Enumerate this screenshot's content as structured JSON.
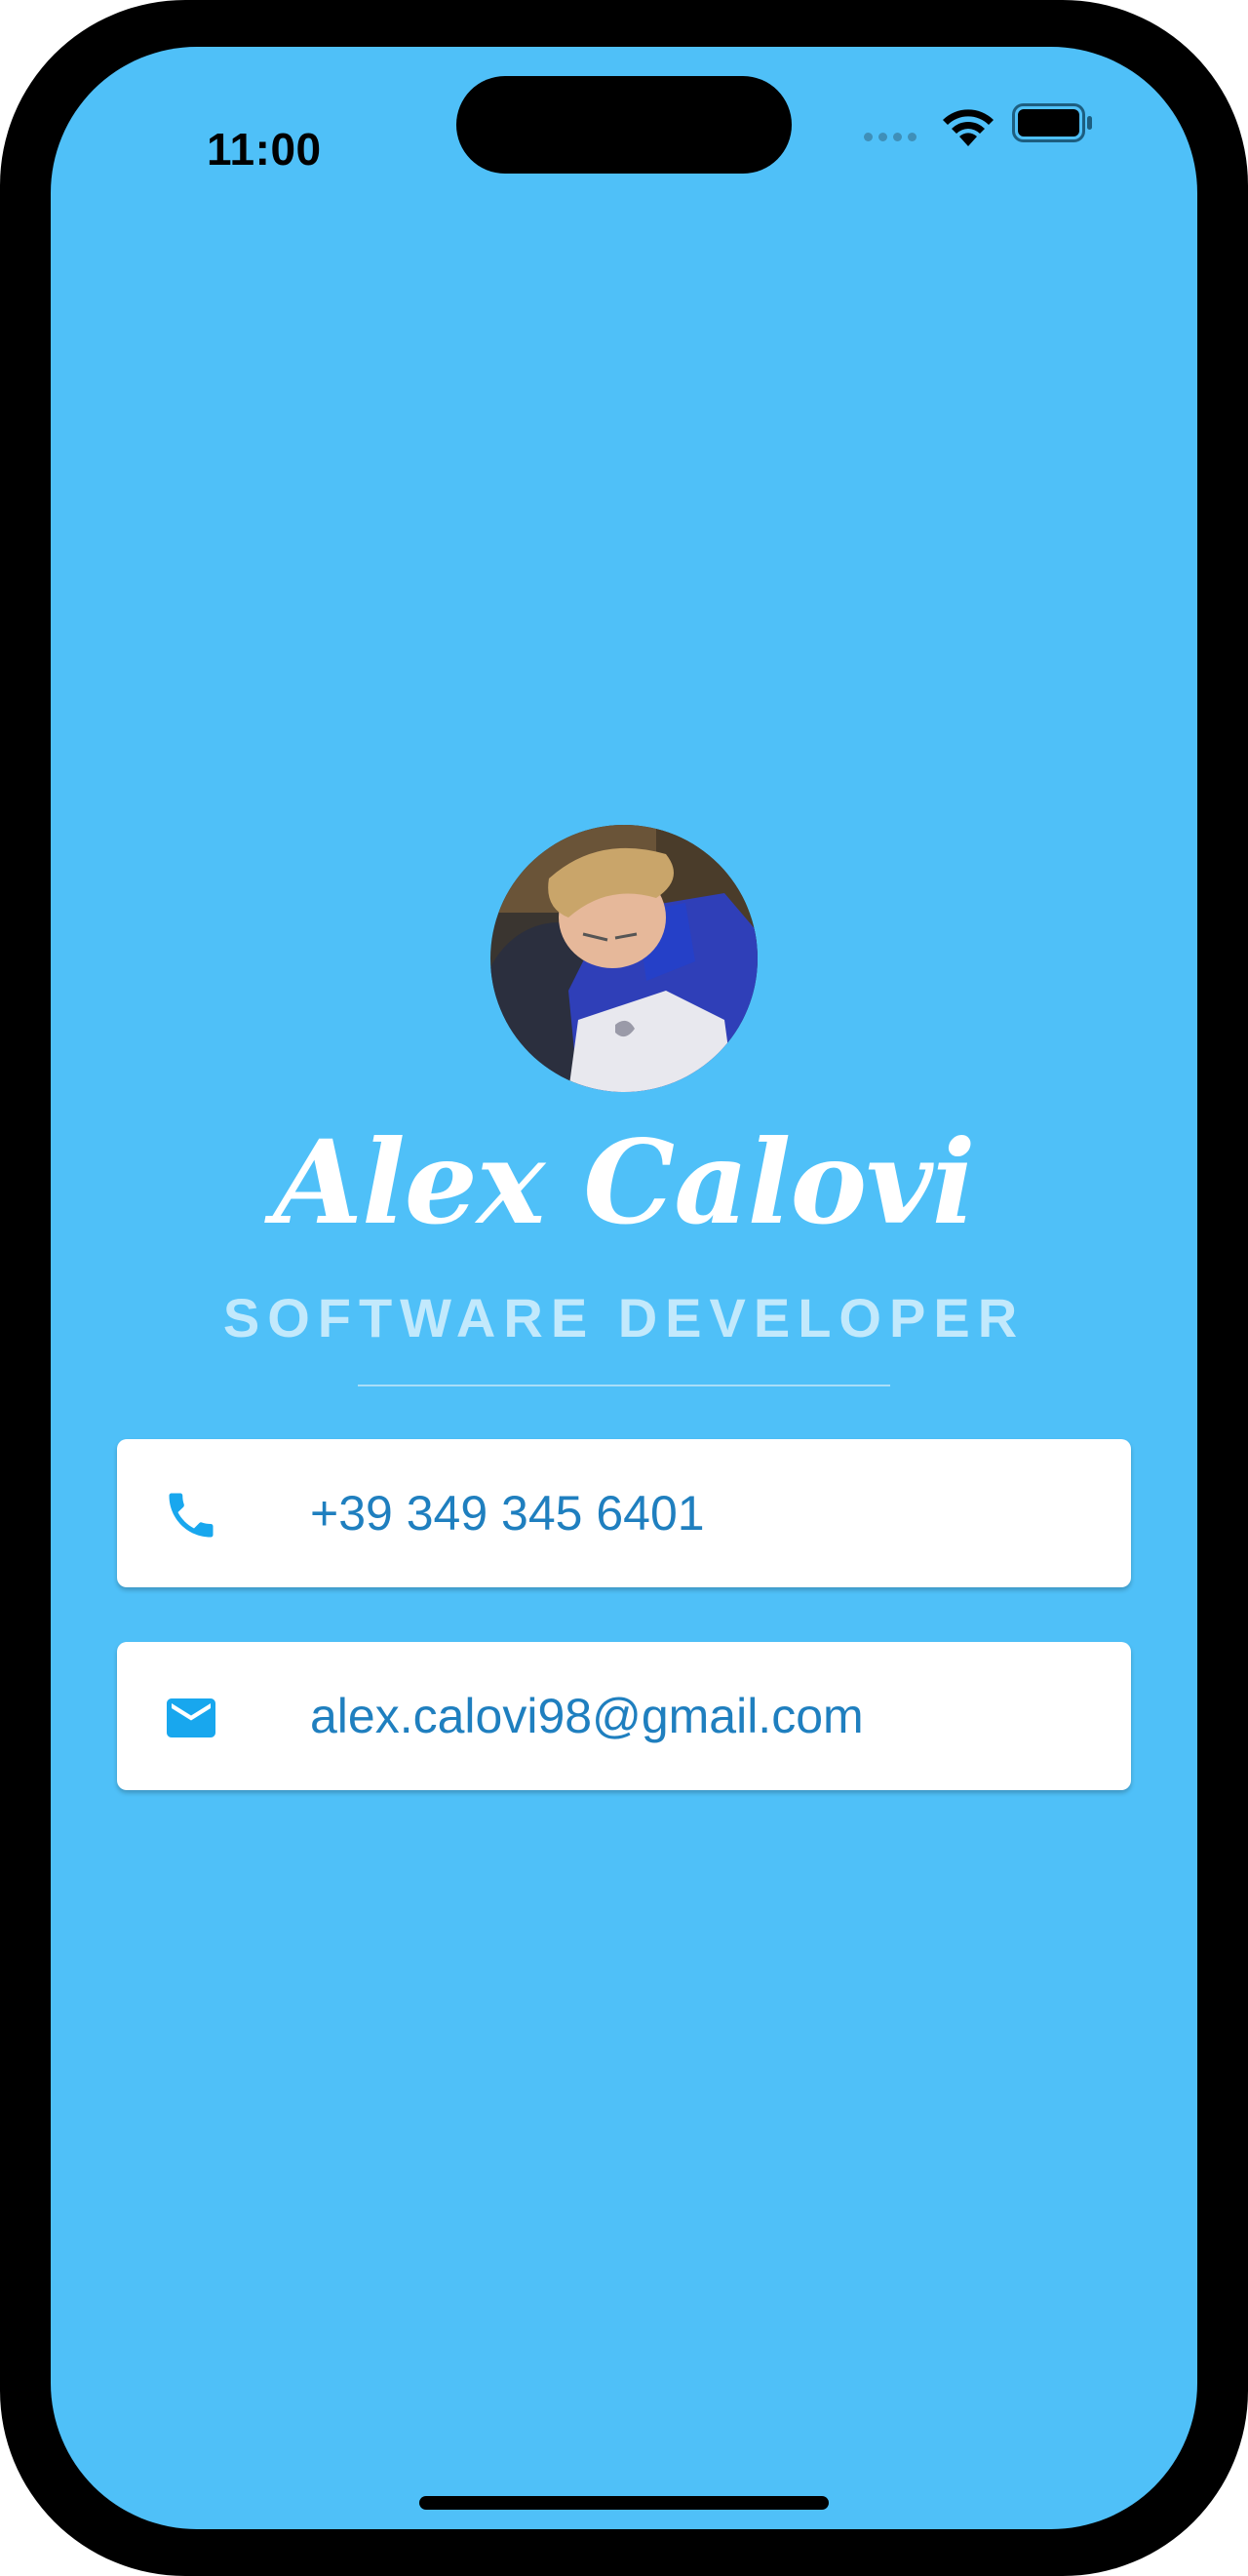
{
  "status_bar": {
    "time": "11:00",
    "wifi_icon": "wifi-icon",
    "battery_icon": "battery-full-icon"
  },
  "profile": {
    "avatar_alt": "Alex Calovi",
    "name": "Alex Calovi",
    "title": "SOFTWARE DEVELOPER"
  },
  "contacts": {
    "phone": {
      "icon": "phone-icon",
      "value": "+39 349 345 6401"
    },
    "email": {
      "icon": "mail-icon",
      "value": "alex.calovi98@gmail.com"
    }
  },
  "colors": {
    "background": "#4fc0f8",
    "card": "#ffffff",
    "accent_text": "#1f7fbf",
    "icon": "#18a7ee",
    "subtitle": "#c2e9fc"
  }
}
